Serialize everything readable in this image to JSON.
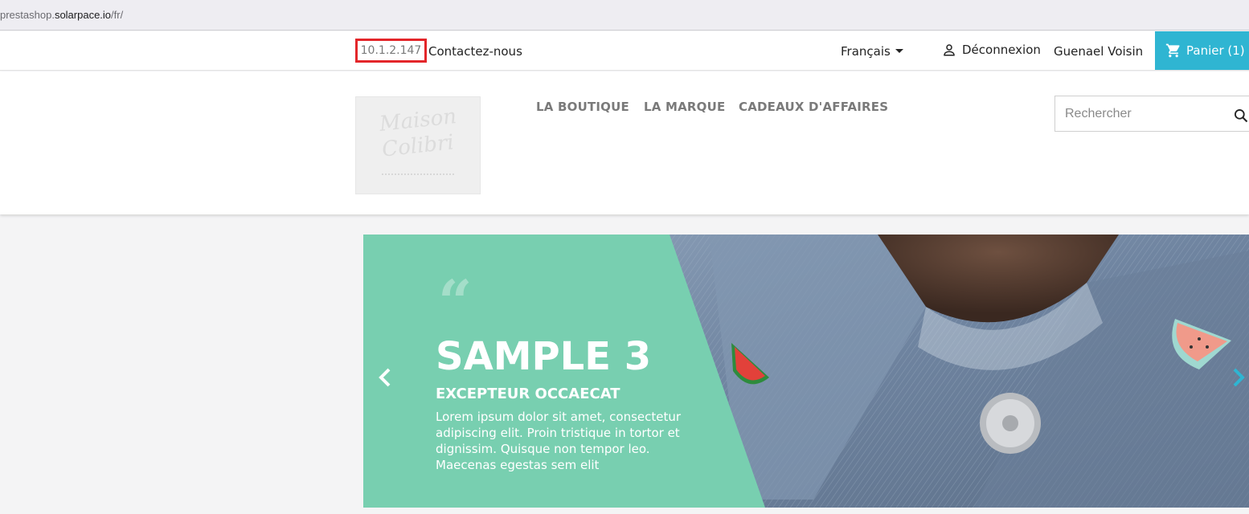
{
  "browser": {
    "url_prefix": "prestashop.",
    "url_host": "solarpace.io",
    "url_path": "/fr/"
  },
  "topnav": {
    "ip_label": "10.1.2.147",
    "contact": "Contactez-nous",
    "language": "Français",
    "logout": "Déconnexion",
    "user_name": "Guenael Voisin",
    "cart": "Panier (1)",
    "cart_color": "#2fb5d2"
  },
  "header": {
    "logo_line1": "Maison",
    "logo_line2": "Colibri",
    "menu": [
      "LA BOUTIQUE",
      "LA MARQUE",
      "CADEAUX D'AFFAIRES"
    ],
    "search_placeholder": "Rechercher"
  },
  "slider": {
    "quote_mark": "“",
    "title": "SAMPLE 3",
    "subtitle": "EXCEPTEUR OCCAECAT",
    "body": "Lorem ipsum dolor sit amet, consectetur adipiscing elit. Proin tristique in tortor et dignissim. Quisque non tempor leo. Maecenas egestas sem elit",
    "panel_color": "#78cfb0",
    "icons": {
      "prev": "chevron-left-icon",
      "next": "chevron-right-icon"
    }
  },
  "colors": {
    "highlight_box": "#e3262a",
    "accent": "#2fb5d2"
  }
}
